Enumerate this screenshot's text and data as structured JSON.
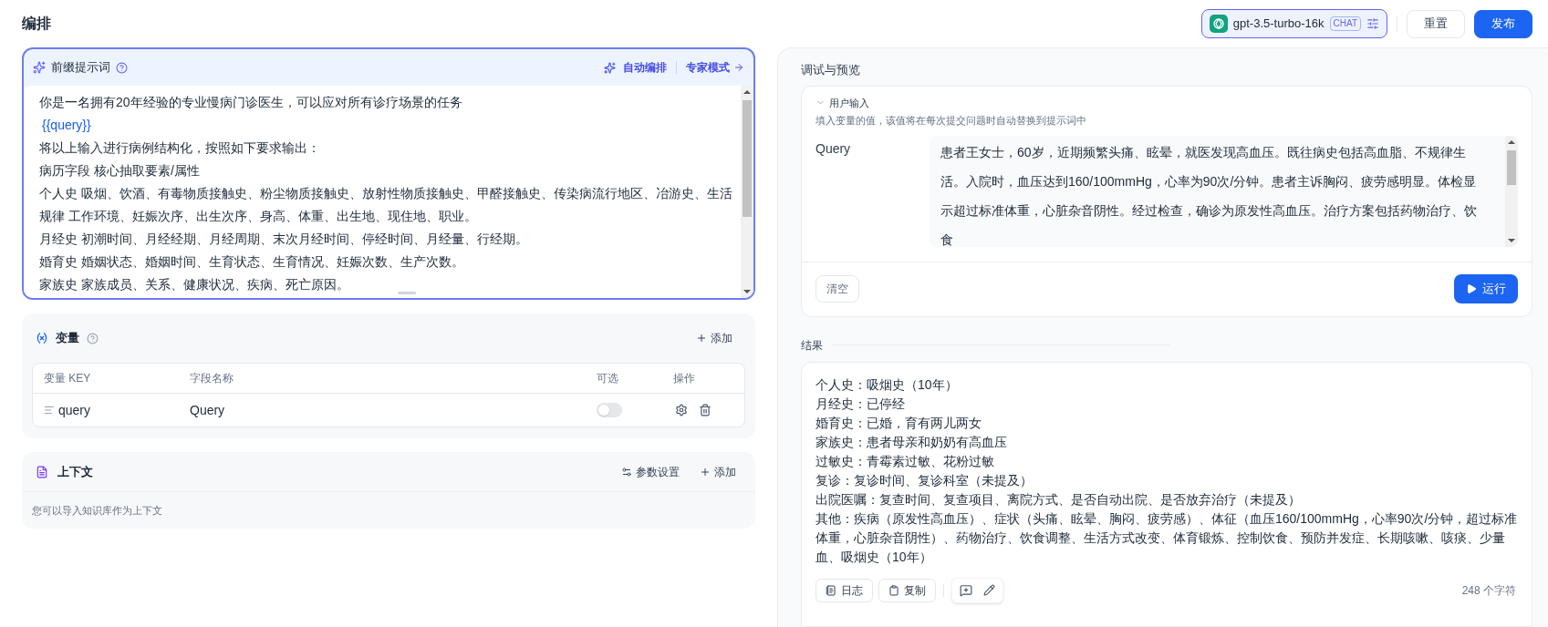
{
  "page_title": "编排",
  "model": {
    "name": "gpt-3.5-turbo-16k",
    "badge": "CHAT"
  },
  "header_buttons": [
    {
      "label": "重置",
      "kind": "secondary"
    },
    {
      "label": "发布",
      "kind": "primary"
    }
  ],
  "prompt": {
    "title": "前缀提示词",
    "auto_label": "自动编排",
    "expert_label": "专家模式",
    "lines": [
      {
        "kind": "plain",
        "text": "你是一名拥有20年经验的专业慢病门诊医生，可以应对所有诊疗场景的任务"
      },
      {
        "kind": "variable",
        "text": "{{query}}"
      },
      {
        "kind": "plain",
        "text": "将以上输入进行病例结构化，按照如下要求输出："
      },
      {
        "kind": "plain",
        "text": "病历字段 核心抽取要素/属性"
      },
      {
        "kind": "plain",
        "text": "个人史 吸烟、饮酒、有毒物质接触史、粉尘物质接触史、放射性物质接触史、甲醛接触史、传染病流行地区、冶游史、生活规律 工作环境、妊娠次序、出生次序、身高、体重、出生地、现住地、职业。"
      },
      {
        "kind": "plain",
        "text": "月经史 初潮时间、月经经期、月经周期、末次月经时间、停经时间、月经量、行经期。"
      },
      {
        "kind": "plain",
        "text": "婚育史 婚姻状态、婚姻时间、生育状态、生育情况、妊娠次数、生产次数。"
      },
      {
        "kind": "plain",
        "text": "家族史 家族成员、关系、健康状况、疾病、死亡原因。"
      }
    ]
  },
  "variables": {
    "title": "变量",
    "add_label": "添加",
    "columns": [
      "变量 KEY",
      "字段名称",
      "可选",
      "操作"
    ],
    "rows": [
      {
        "key": "query",
        "name": "Query",
        "optional": false
      }
    ]
  },
  "context": {
    "title": "上下文",
    "settings_label": "参数设置",
    "add_label": "添加",
    "hint": "您可以导入知识库作为上下文"
  },
  "preview": {
    "title": "调试与预览",
    "input": {
      "title": "用户输入",
      "expanded": true,
      "hint": "填入变量的值，该值将在每次提交问题时自动替换到提示词中",
      "fields": [
        {
          "label": "Query",
          "value": "患者王女士，60岁，近期频繁头痛、眩晕，就医发现高血压。既往病史包括高血脂、不规律生活。入院时，血压达到160/100mmHg，心率为90次/分钟。患者主诉胸闷、疲劳感明显。体检显示超过标准体重，心脏杂音阴性。经过检查，确诊为原发性高血压。治疗方案包括药物治疗、饮食"
        }
      ]
    },
    "clear_label": "清空",
    "run_label": "运行"
  },
  "result": {
    "title": "结果",
    "lines": [
      "个人史：吸烟史（10年）",
      "月经史：已停经",
      "婚育史：已婚，育有两儿两女",
      "家族史：患者母亲和奶奶有高血压",
      "过敏史：青霉素过敏、花粉过敏",
      "复诊：复诊时间、复诊科室（未提及）",
      "出院医嘱：复查时间、复查项目、离院方式、是否自动出院、是否放弃治疗（未提及）",
      "其他：疾病（原发性高血压）、症状（头痛、眩晕、胸闷、疲劳感）、体征（血压160/100mmHg，心率90次/分钟，超过标准体重，心脏杂音阴性）、药物治疗、饮食调整、生活方式改变、体育锻炼、控制饮食、预防并发症、长期咳嗽、咳痰、少量血、吸烟史（10年）"
    ],
    "buttons": [
      "日志",
      "复制"
    ],
    "count": "248 个字符"
  }
}
